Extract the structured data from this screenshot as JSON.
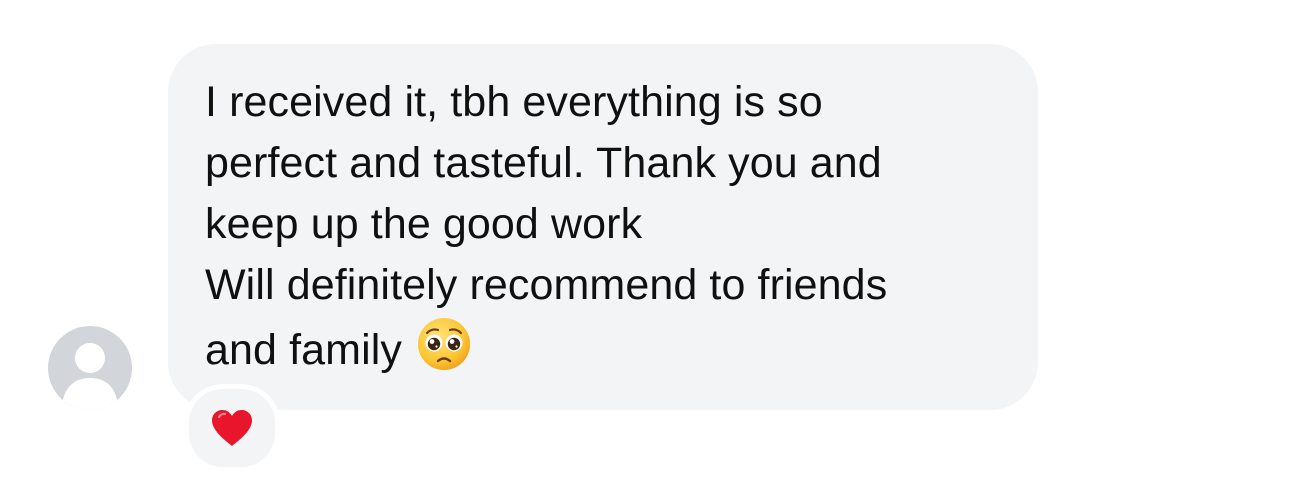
{
  "message": {
    "lines": [
      "I received it, tbh everything is so",
      "perfect and tasteful. Thank you and",
      "keep up the good work",
      "Will definitely recommend to friends",
      "and family"
    ],
    "inline_emoji": "pleading-face-icon"
  },
  "reaction": {
    "icon": "heart-icon",
    "color": "#e8152d"
  },
  "colors": {
    "bubble": "#f3f4f6",
    "avatar": "#d2d5da",
    "text": "#101010"
  }
}
